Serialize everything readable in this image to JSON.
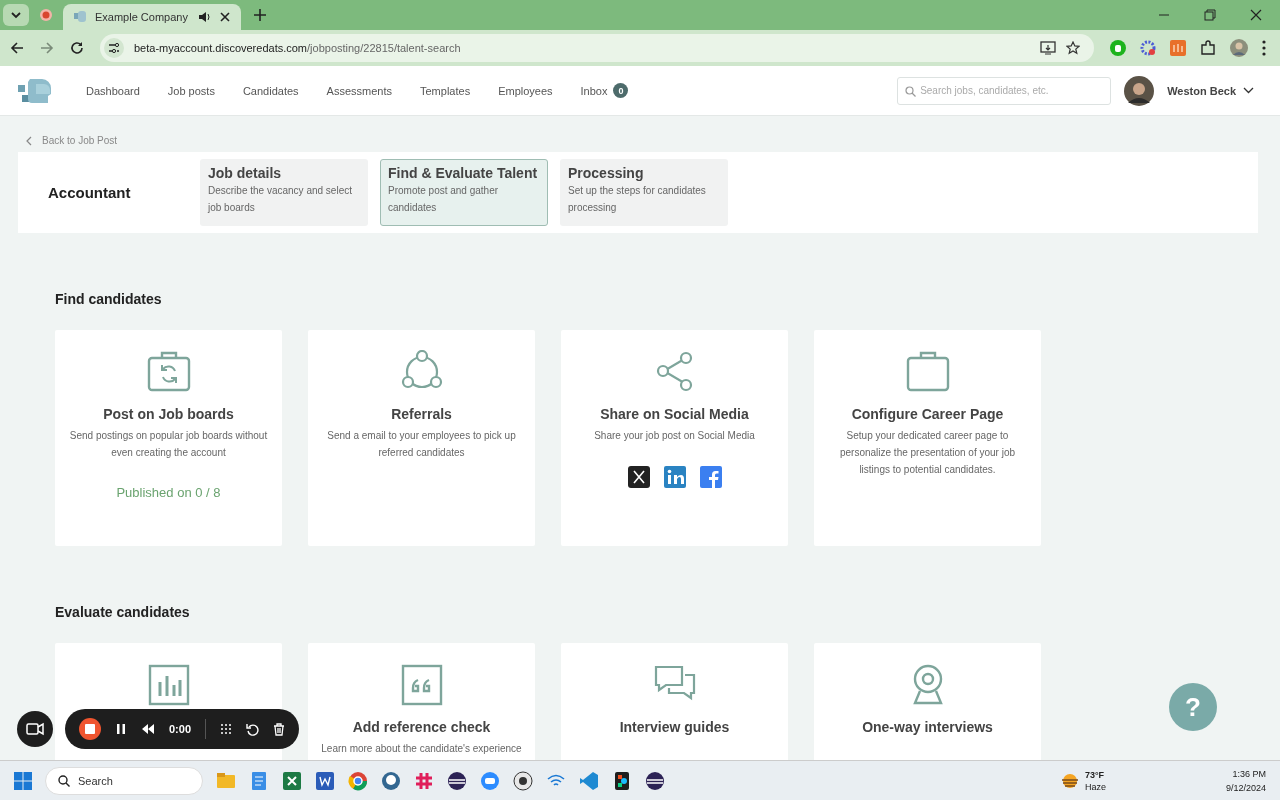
{
  "browser": {
    "tabs": [
      {
        "title": "Example Company",
        "selected": true
      }
    ],
    "url": {
      "host": "beta-myaccount.discoveredats.com",
      "path": "/jobposting/22815/talent-search"
    }
  },
  "header": {
    "nav": [
      {
        "label": "Dashboard"
      },
      {
        "label": "Job posts"
      },
      {
        "label": "Candidates"
      },
      {
        "label": "Assessments"
      },
      {
        "label": "Templates"
      },
      {
        "label": "Employees"
      },
      {
        "label": "Inbox",
        "badge": "0"
      }
    ],
    "search": {
      "placeholder": "Search jobs, candidates, etc."
    },
    "user": {
      "name": "Weston Beck"
    }
  },
  "back_link": "Back to Job Post",
  "job_title": "Accountant",
  "steps": [
    {
      "title": "Job details",
      "description": "Describe the vacancy and select job boards",
      "selected": false
    },
    {
      "title": "Find & Evaluate Talent",
      "description": "Promote post and gather candidates",
      "selected": true
    },
    {
      "title": "Processing",
      "description": "Set up the steps for candidates processing",
      "selected": false
    }
  ],
  "sections": [
    {
      "heading": "Find candidates",
      "cards": [
        {
          "kind": "job-boards",
          "title": "Post on Job boards",
          "description": "Send postings on popular job boards without even creating the account",
          "status": "Published on 0 / 8"
        },
        {
          "kind": "referrals",
          "title": "Referrals",
          "description": "Send a email to your employees to pick up referred candidates"
        },
        {
          "kind": "social",
          "title": "Share on Social Media",
          "description": "Share your job post on Social Media"
        },
        {
          "kind": "career-page",
          "title": "Configure Career Page",
          "description": "Setup your dedicated career page to personalize the presentation of your job listings to potential candidates."
        }
      ]
    },
    {
      "heading": "Evaluate candidates",
      "cards": [
        {
          "kind": "assessments"
        },
        {
          "kind": "reference",
          "title": "Add reference check",
          "description": "Learn more about the candidate's experience"
        },
        {
          "kind": "guides",
          "title": "Interview guides"
        },
        {
          "kind": "one-way",
          "title": "One-way interviews"
        }
      ]
    }
  ],
  "help_button": "?",
  "recorder": {
    "time": "0:00"
  },
  "taskbar": {
    "search": {
      "placeholder": "Search"
    },
    "weather": {
      "temperature": "73°F",
      "condition": "Haze"
    },
    "time": "1:36 PM",
    "date": "9/12/2024"
  }
}
